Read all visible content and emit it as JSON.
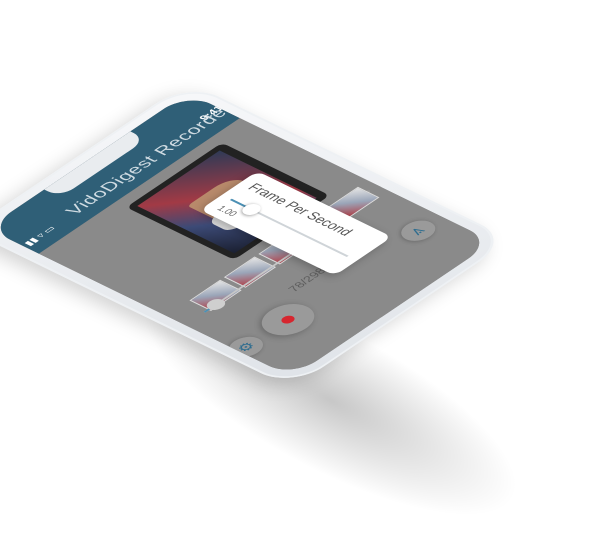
{
  "status": {
    "time": "9:41",
    "icons_text": "▮▮ ▿ ▭"
  },
  "app": {
    "title": "VidoDigest Recorder"
  },
  "dialog": {
    "title": "Frame Per Second",
    "value": "1.00",
    "slider_fraction": 0.18
  },
  "playback": {
    "counter": "78/298",
    "progress_fraction": 0.1
  },
  "icons": {
    "record": "record-icon",
    "share": "share-icon",
    "settings": "gear-icon"
  },
  "colors": {
    "header": "#2f5f77",
    "accent": "#4b90b5",
    "record": "#d6262f",
    "overlay": "#8a8a8a"
  }
}
